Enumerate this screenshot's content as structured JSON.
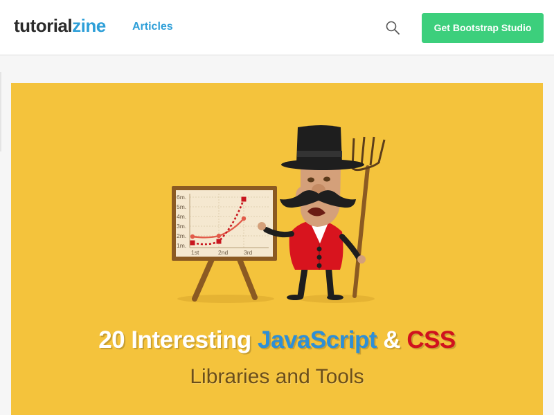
{
  "header": {
    "logo": {
      "part1": "tutorial",
      "part2": "zine"
    },
    "nav": {
      "articles": "Articles"
    },
    "search_icon": "search-icon",
    "cta_label": "Get Bootstrap Studio"
  },
  "hero": {
    "title": {
      "part1": "20 Interesting ",
      "javascript": "JavaScript",
      "part2": " & ",
      "css": "CSS"
    },
    "subtitle": "Libraries and Tools",
    "chart": {
      "y_labels": [
        "6m.",
        "5m.",
        "4m.",
        "3m.",
        "2m.",
        "1m."
      ],
      "x_labels": [
        "1st",
        "2nd",
        "3rd"
      ]
    }
  },
  "colors": {
    "brand_blue": "#2e9fd8",
    "cta_green": "#3ccf7c",
    "hero_yellow": "#f4c33c",
    "accent_red": "#d0121e"
  }
}
